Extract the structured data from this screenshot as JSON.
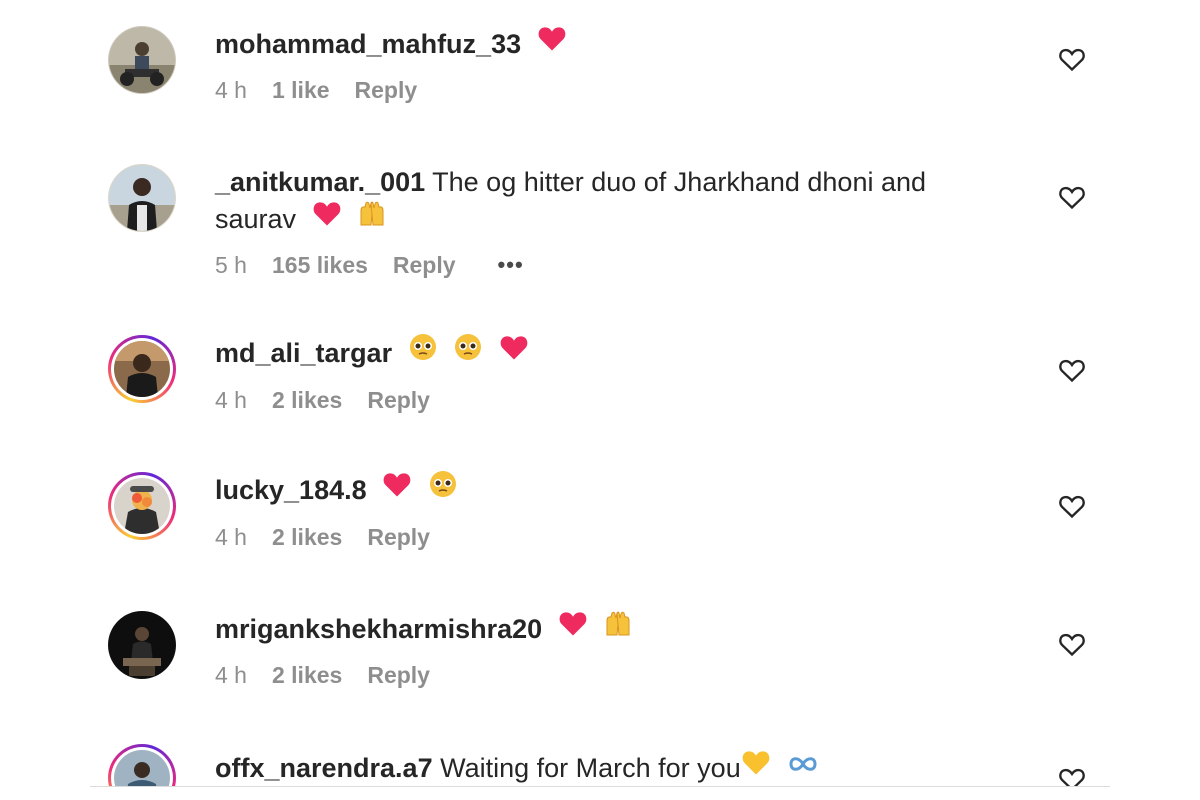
{
  "comments": [
    {
      "username": "mohammad_mahfuz_33",
      "text": "",
      "emojis": [
        "heart-icon"
      ],
      "time": "4 h",
      "likes": "1 like",
      "reply": "Reply",
      "story_ring": false
    },
    {
      "username": "_anitkumar._001",
      "text": "The og hitter duo of Jharkhand dhoni and saurav",
      "emojis": [
        "heart-icon",
        "raising-hands-icon"
      ],
      "time": "5 h",
      "likes": "165 likes",
      "reply": "Reply",
      "more": "•••",
      "story_ring": false
    },
    {
      "username": "md_ali_targar",
      "text": "",
      "emojis": [
        "pleading-face-icon",
        "pleading-face-icon",
        "heart-icon"
      ],
      "time": "4 h",
      "likes": "2 likes",
      "reply": "Reply",
      "story_ring": true
    },
    {
      "username": "lucky_184.8",
      "text": "",
      "emojis": [
        "heart-icon",
        "pleading-face-icon"
      ],
      "time": "4 h",
      "likes": "2 likes",
      "reply": "Reply",
      "story_ring": true
    },
    {
      "username": "mrigankshekharmishra20",
      "text": "",
      "emojis": [
        "heart-icon",
        "raising-hands-icon"
      ],
      "time": "4 h",
      "likes": "2 likes",
      "reply": "Reply",
      "story_ring": false
    },
    {
      "username": "offx_narendra.a7",
      "text": "Waiting for March for you",
      "emojis": [
        "yellow-heart-icon",
        "infinity-icon"
      ],
      "story_ring": true
    }
  ],
  "colors": {
    "heart": "#ee2a5e",
    "yellow_heart": "#f9c12e",
    "meta_text": "#8e8e8e",
    "username": "#262626"
  }
}
